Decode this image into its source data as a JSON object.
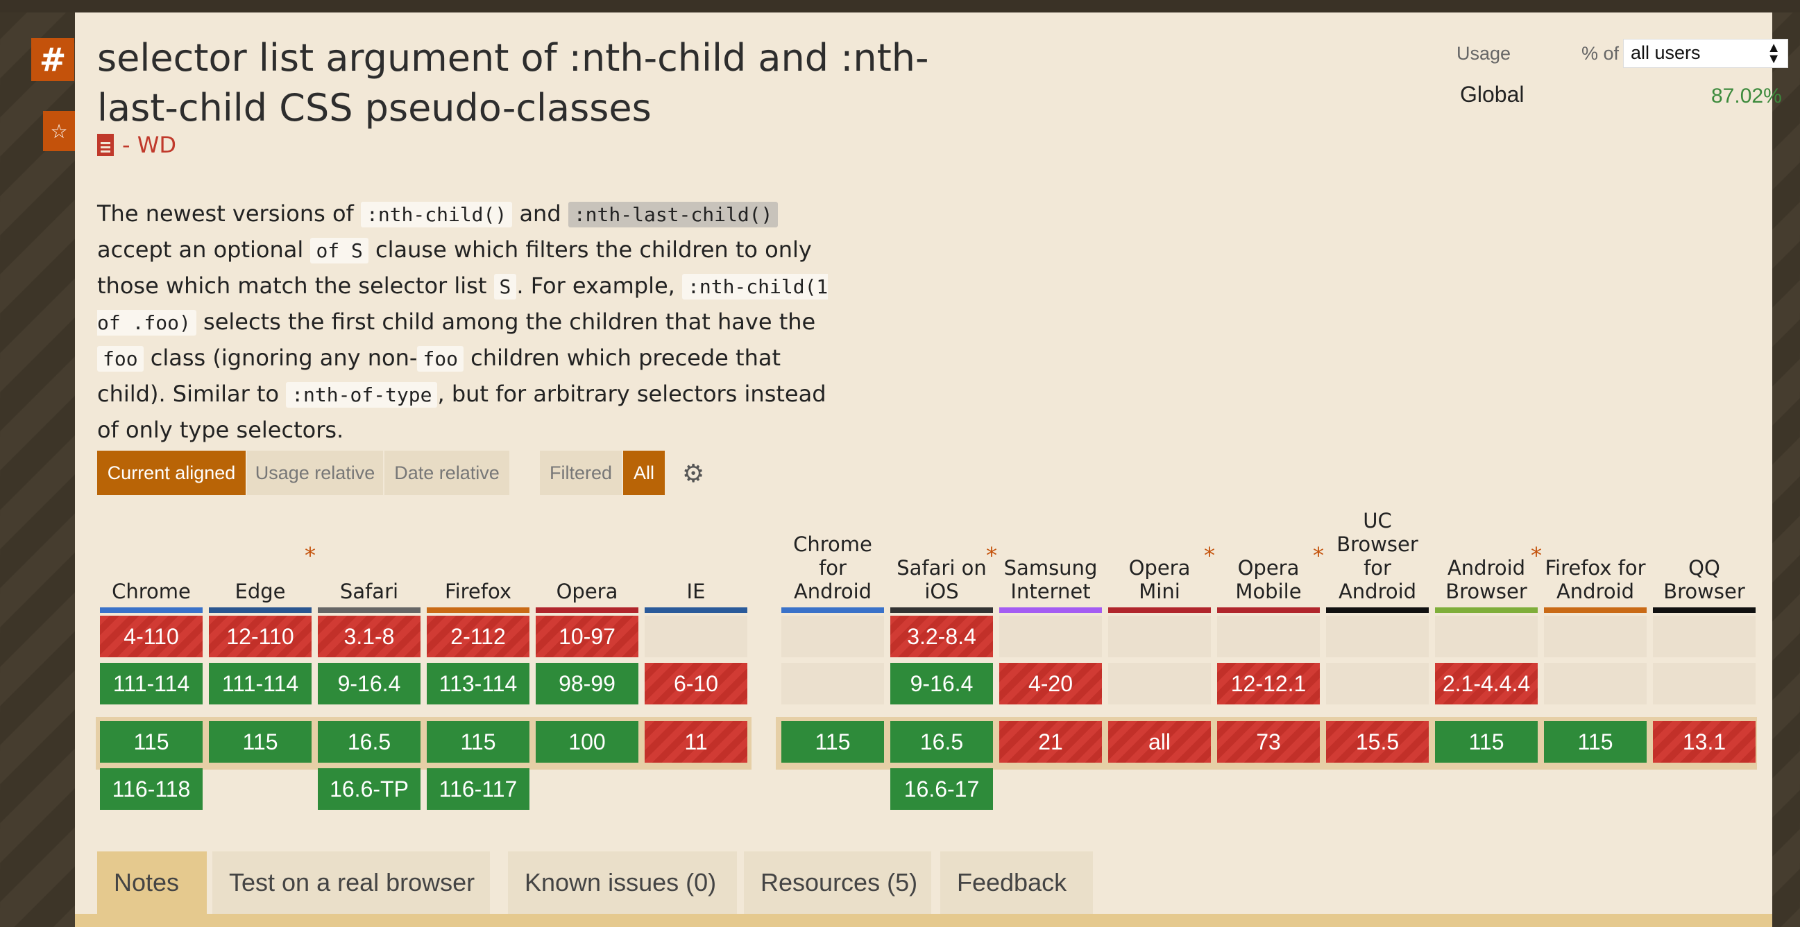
{
  "page": {
    "title": "selector list argument of :nth-child and :nth-last-child CSS pseudo-classes",
    "status": "- WD",
    "description": {
      "t1": "The newest versions of ",
      "c1": ":nth-child()",
      "t2": " and ",
      "c2": ":nth-last-child()",
      "t3": " accept an optional ",
      "c3": "of S",
      "t4": " clause which filters the children to only those which match the selector list ",
      "c4": "S",
      "t5": ". For example, ",
      "c5": ":nth-child(1 of .foo)",
      "t6": " selects the first child among the children that have the ",
      "c6": "foo",
      "t7": " class (ignoring any non-",
      "c7": "foo",
      "t8": " children which precede that child). Similar to ",
      "c8": ":nth-of-type",
      "t9": ", but for arbitrary selectors instead of only type selectors."
    }
  },
  "side": {
    "hash": "#",
    "star": "☆"
  },
  "usage": {
    "label": "Usage",
    "pct_of": "% of",
    "users_select": "all users",
    "help": "?",
    "region": "Global",
    "value": "87.02%"
  },
  "view_buttons": {
    "current_aligned": "Current aligned",
    "usage_relative": "Usage relative",
    "date_relative": "Date relative",
    "filtered": "Filtered",
    "all": "All"
  },
  "colors": {
    "supported": "#2e8b3a",
    "unsupported": "#d13b34",
    "accent": "#b96406"
  },
  "browsers": [
    {
      "name": "Chrome",
      "bar": "#3a72c9",
      "ast": false,
      "cells": [
        [
          "n",
          "4-110"
        ],
        [
          "y",
          "111-114"
        ],
        [
          "y",
          "115"
        ],
        [
          "y",
          "116-118"
        ]
      ]
    },
    {
      "name": "Edge",
      "bar": "#2a5690",
      "ast": true,
      "cells": [
        [
          "n",
          "12-110"
        ],
        [
          "y",
          "111-114"
        ],
        [
          "y",
          "115"
        ],
        [
          "",
          ""
        ]
      ]
    },
    {
      "name": "Safari",
      "bar": "#666666",
      "ast": false,
      "cells": [
        [
          "n",
          "3.1-8"
        ],
        [
          "y",
          "9-16.4"
        ],
        [
          "y",
          "16.5"
        ],
        [
          "y",
          "16.6-TP"
        ]
      ]
    },
    {
      "name": "Firefox",
      "bar": "#c96a16",
      "ast": false,
      "cells": [
        [
          "n",
          "2-112"
        ],
        [
          "y",
          "113-114"
        ],
        [
          "y",
          "115"
        ],
        [
          "y",
          "116-117"
        ]
      ]
    },
    {
      "name": "Opera",
      "bar": "#b0262c",
      "ast": false,
      "cells": [
        [
          "n",
          "10-97"
        ],
        [
          "y",
          "98-99"
        ],
        [
          "y",
          "100"
        ],
        [
          "",
          ""
        ]
      ]
    },
    {
      "name": "IE",
      "bar": "#2a5a9a",
      "ast": false,
      "cells": [
        [
          "e",
          ""
        ],
        [
          "n",
          "6-10"
        ],
        [
          "n",
          "11"
        ],
        [
          "",
          ""
        ]
      ]
    },
    {
      "name": "Chrome for Android",
      "bar": "#3a72c9",
      "ast": false,
      "cells": [
        [
          "e",
          ""
        ],
        [
          "e",
          ""
        ],
        [
          "y",
          "115"
        ],
        [
          "",
          ""
        ]
      ]
    },
    {
      "name": "Safari on iOS",
      "bar": "#333333",
      "ast": true,
      "cells": [
        [
          "n",
          "3.2-8.4"
        ],
        [
          "y",
          "9-16.4"
        ],
        [
          "y",
          "16.5"
        ],
        [
          "y",
          "16.6-17"
        ]
      ]
    },
    {
      "name": "Samsung Internet",
      "bar": "#a45cf2",
      "ast": false,
      "cells": [
        [
          "e",
          ""
        ],
        [
          "n",
          "4-20"
        ],
        [
          "n",
          "21"
        ],
        [
          "",
          ""
        ]
      ]
    },
    {
      "name": "Opera Mini",
      "bar": "#b0262c",
      "ast": true,
      "cells": [
        [
          "e",
          ""
        ],
        [
          "e",
          ""
        ],
        [
          "n",
          "all"
        ],
        [
          "",
          ""
        ]
      ]
    },
    {
      "name": "Opera Mobile",
      "bar": "#b0262c",
      "ast": true,
      "cells": [
        [
          "e",
          ""
        ],
        [
          "n",
          "12-12.1"
        ],
        [
          "n",
          "73"
        ],
        [
          "",
          ""
        ]
      ]
    },
    {
      "name": "UC Browser for Android",
      "bar": "#111111",
      "ast": false,
      "cells": [
        [
          "e",
          ""
        ],
        [
          "e",
          ""
        ],
        [
          "n",
          "15.5"
        ],
        [
          "",
          ""
        ]
      ]
    },
    {
      "name": "Android Browser",
      "bar": "#7fae3a",
      "ast": true,
      "cells": [
        [
          "e",
          ""
        ],
        [
          "n",
          "2.1-4.4.4"
        ],
        [
          "y",
          "115"
        ],
        [
          "",
          ""
        ]
      ]
    },
    {
      "name": "Firefox for Android",
      "bar": "#c96a16",
      "ast": false,
      "cells": [
        [
          "e",
          ""
        ],
        [
          "e",
          ""
        ],
        [
          "y",
          "115"
        ],
        [
          "",
          ""
        ]
      ]
    },
    {
      "name": "QQ Browser",
      "bar": "#111111",
      "ast": false,
      "cells": [
        [
          "e",
          ""
        ],
        [
          "e",
          ""
        ],
        [
          "n",
          "13.1"
        ],
        [
          "",
          ""
        ]
      ]
    }
  ],
  "tabs": [
    "Notes",
    "Test on a real browser",
    "Known issues (0)",
    "Resources (5)",
    "Feedback"
  ]
}
